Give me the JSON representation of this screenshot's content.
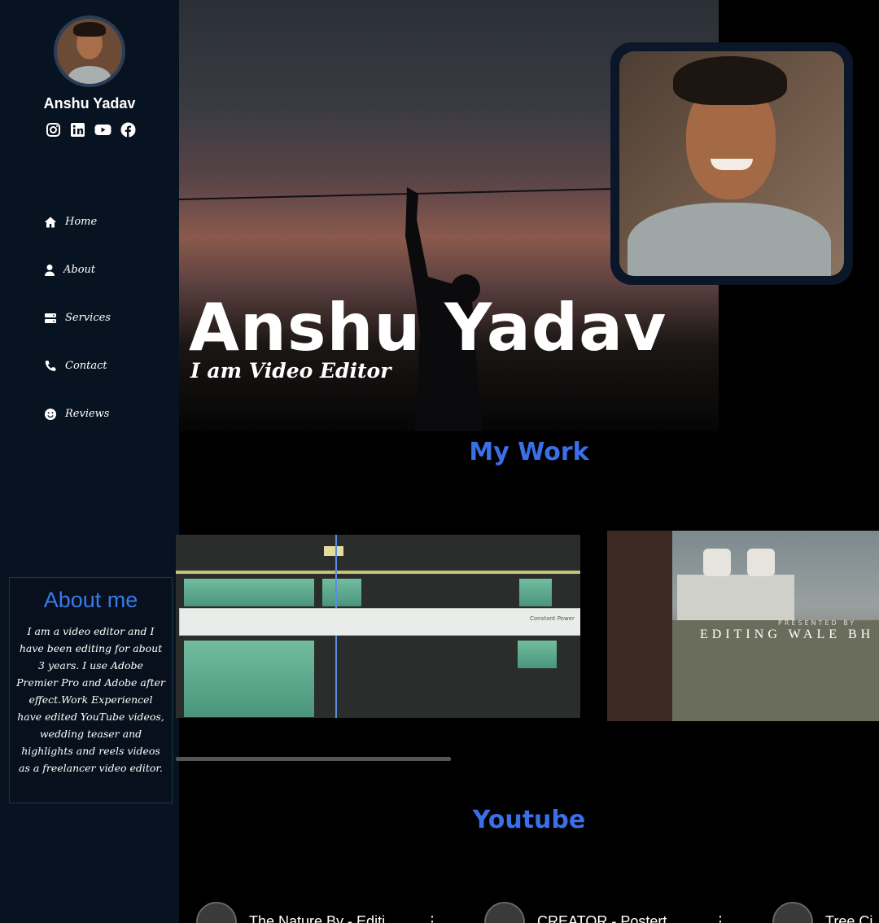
{
  "sidebar": {
    "name": "Anshu Yadav",
    "socials": [
      {
        "icon": "instagram-icon"
      },
      {
        "icon": "linkedin-icon"
      },
      {
        "icon": "youtube-icon"
      },
      {
        "icon": "facebook-icon"
      }
    ],
    "nav": [
      {
        "icon": "home-icon",
        "label": "Home"
      },
      {
        "icon": "user-icon",
        "label": "About"
      },
      {
        "icon": "server-icon",
        "label": "Services"
      },
      {
        "icon": "phone-icon",
        "label": "Contact"
      },
      {
        "icon": "smile-icon",
        "label": "Reviews"
      }
    ]
  },
  "about": {
    "title": "About me",
    "text": "I am a video editor and I have been editing for about 3 years. I use Adobe Premier Pro and Adobe after effect.Work Experiencel have edited YouTube videos, wedding teaser and highlights and reels videos as a freelancer video editor."
  },
  "hero": {
    "title": "Anshu Yadav",
    "subtitle": "I am Video Editor"
  },
  "work": {
    "title": "My Work",
    "video1": {
      "clip_label": "Constant Power"
    },
    "video2": {
      "presented": "PRESENTED BY",
      "caption": "EDITING WALE BH"
    }
  },
  "youtube": {
    "title": "Youtube",
    "cards": [
      {
        "title": "The Nature By - Editi"
      },
      {
        "title": "CREATOR - Postert"
      },
      {
        "title": "Tree Ci"
      }
    ]
  },
  "colors": {
    "accent": "#3a6fe8",
    "sidebar": "#081321"
  }
}
